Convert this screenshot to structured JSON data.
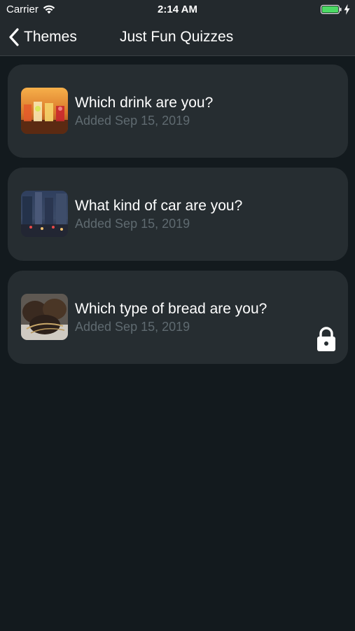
{
  "status_bar": {
    "carrier": "Carrier",
    "time": "2:14 AM",
    "battery_icon": "battery-full-charging-icon",
    "battery_color": "#4cd964"
  },
  "nav": {
    "back_label": "Themes",
    "title": "Just Fun Quizzes"
  },
  "quizzes": [
    {
      "title": "Which drink are you?",
      "date": "Added Sep 15, 2019",
      "thumbnail": "drinks-photo",
      "locked": false
    },
    {
      "title": "What kind of car are you?",
      "date": "Added Sep 15, 2019",
      "thumbnail": "city-street-photo",
      "locked": false
    },
    {
      "title": "Which type of bread are you?",
      "date": "Added Sep 15, 2019",
      "thumbnail": "bread-photo",
      "locked": true
    }
  ],
  "colors": {
    "background": "#131a1e",
    "card": "#262d31",
    "bar": "#23292d",
    "subtitle": "#5f6a70"
  }
}
